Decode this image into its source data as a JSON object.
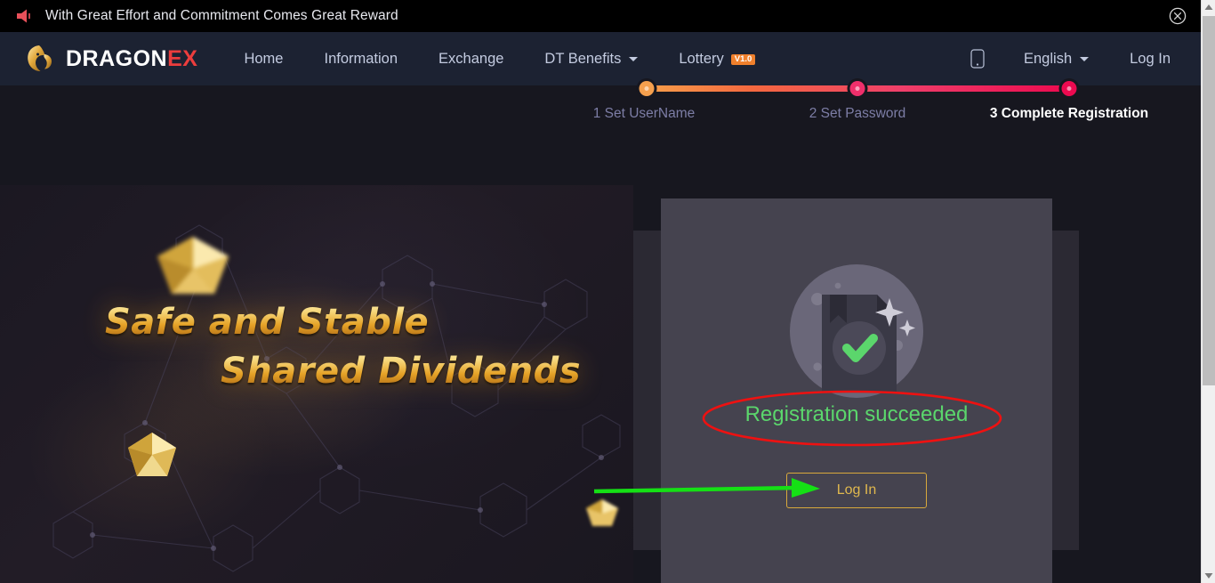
{
  "announcement": {
    "icon": "megaphone-icon",
    "text": "With Great Effort and Commitment Comes Great Reward",
    "close_icon": "close-circle-icon"
  },
  "nav": {
    "logo": {
      "icon": "dragon-head-icon",
      "text_primary": "DRAGON",
      "text_accent": "EX"
    },
    "links": [
      {
        "label": "Home",
        "has_caret": false
      },
      {
        "label": "Information",
        "has_caret": false
      },
      {
        "label": "Exchange",
        "has_caret": false
      },
      {
        "label": "DT Benefits",
        "has_caret": true
      },
      {
        "label": "Lottery",
        "badge": "V1.0",
        "has_caret": false
      }
    ],
    "mobile_icon": "mobile-phone-icon",
    "language": {
      "label": "English",
      "caret": true
    },
    "login_label": "Log In"
  },
  "stepper": {
    "steps": [
      {
        "label": "1 Set UserName",
        "state": "done",
        "color": "#f5a04e"
      },
      {
        "label": "2 Set Password",
        "state": "done",
        "color": "#ef2f6b"
      },
      {
        "label": "3 Complete Registration",
        "state": "active",
        "color": "#ec0a50"
      }
    ]
  },
  "hero": {
    "line1": "Safe and Stable",
    "line2": "Shared Dividends"
  },
  "card": {
    "illustration": "document-check-illustration",
    "success_message": "Registration succeeded",
    "success_color": "#5bd66c",
    "login_button": "Log In",
    "login_button_color": "#e0b84e"
  },
  "annotations": {
    "ellipse_color": "#ee1111",
    "arrow_color": "#15e015"
  },
  "scrollbar": {
    "up_icon": "scroll-up-arrow-icon",
    "down_icon": "scroll-down-arrow-icon"
  }
}
